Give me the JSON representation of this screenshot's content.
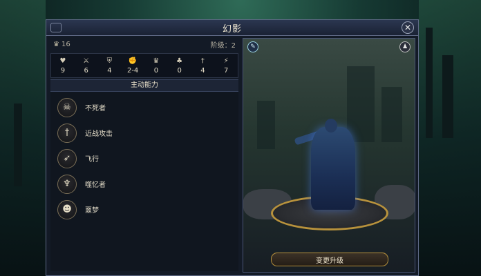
{
  "window": {
    "title": "幻影",
    "close_icon": "close-icon"
  },
  "unit": {
    "race_icon": "crown-icon",
    "count": "16",
    "tier_label": "阶级：2"
  },
  "stats": [
    {
      "icon": "heart-icon",
      "value": "9"
    },
    {
      "icon": "swords-icon",
      "value": "6"
    },
    {
      "icon": "shield-icon",
      "value": "4"
    },
    {
      "icon": "fist-icon",
      "value": "2-4"
    },
    {
      "icon": "crown-icon",
      "value": "0"
    },
    {
      "icon": "clover-icon",
      "value": "0"
    },
    {
      "icon": "sword-icon",
      "value": "4"
    },
    {
      "icon": "boot-icon",
      "value": "7"
    }
  ],
  "abilities_header": "主动能力",
  "abilities": [
    {
      "icon": "skull-icon",
      "label": "不死者"
    },
    {
      "icon": "sword-icon",
      "label": "近战攻击"
    },
    {
      "icon": "wing-icon",
      "label": "飞行"
    },
    {
      "icon": "hooded-skull-icon",
      "label": "噬忆者"
    },
    {
      "icon": "mask-icon",
      "label": "噩梦"
    }
  ],
  "preview": {
    "settings_icon": "gear-icon",
    "portrait_icon": "portrait-icon",
    "upgrade_label": "变更升级"
  }
}
